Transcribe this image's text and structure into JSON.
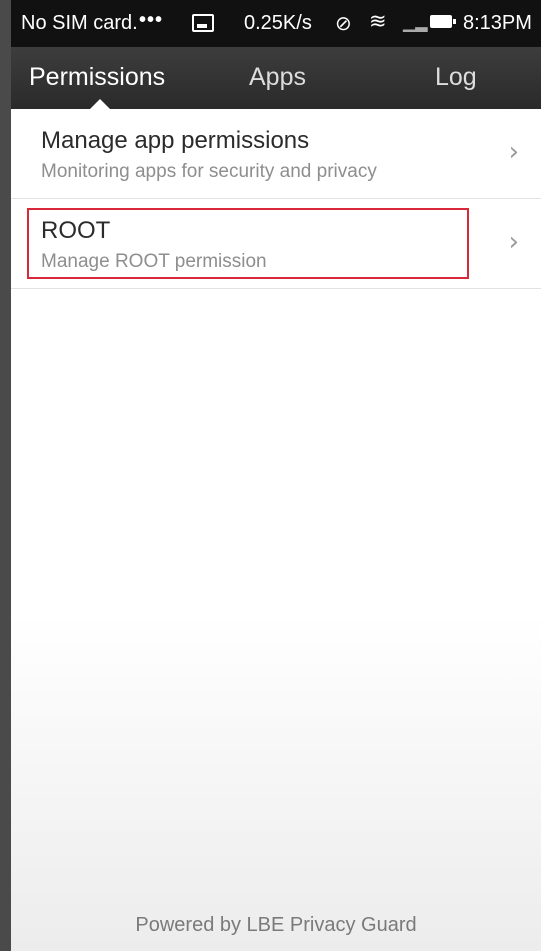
{
  "status_bar": {
    "carrier": "No SIM card.",
    "dots": "•••",
    "speed": "0.25K/s",
    "time": "8:13PM",
    "icons": [
      "image-icon",
      "vibrate-off-icon",
      "wifi-icon",
      "signal-icon",
      "battery-icon"
    ]
  },
  "tabs": [
    {
      "label": "Permissions",
      "active": true
    },
    {
      "label": "Apps",
      "active": false
    },
    {
      "label": "Log",
      "active": false
    }
  ],
  "list": [
    {
      "title": "Manage app permissions",
      "subtitle": "Monitoring apps for security and privacy",
      "chevron": "›"
    },
    {
      "title": "ROOT",
      "subtitle": "Manage ROOT permission",
      "chevron": "›",
      "highlighted": true
    }
  ],
  "footer": "Powered by LBE Privacy Guard",
  "colors": {
    "highlight": "#d9283a",
    "tab_bar": "#333333",
    "status_bar": "#111111"
  }
}
